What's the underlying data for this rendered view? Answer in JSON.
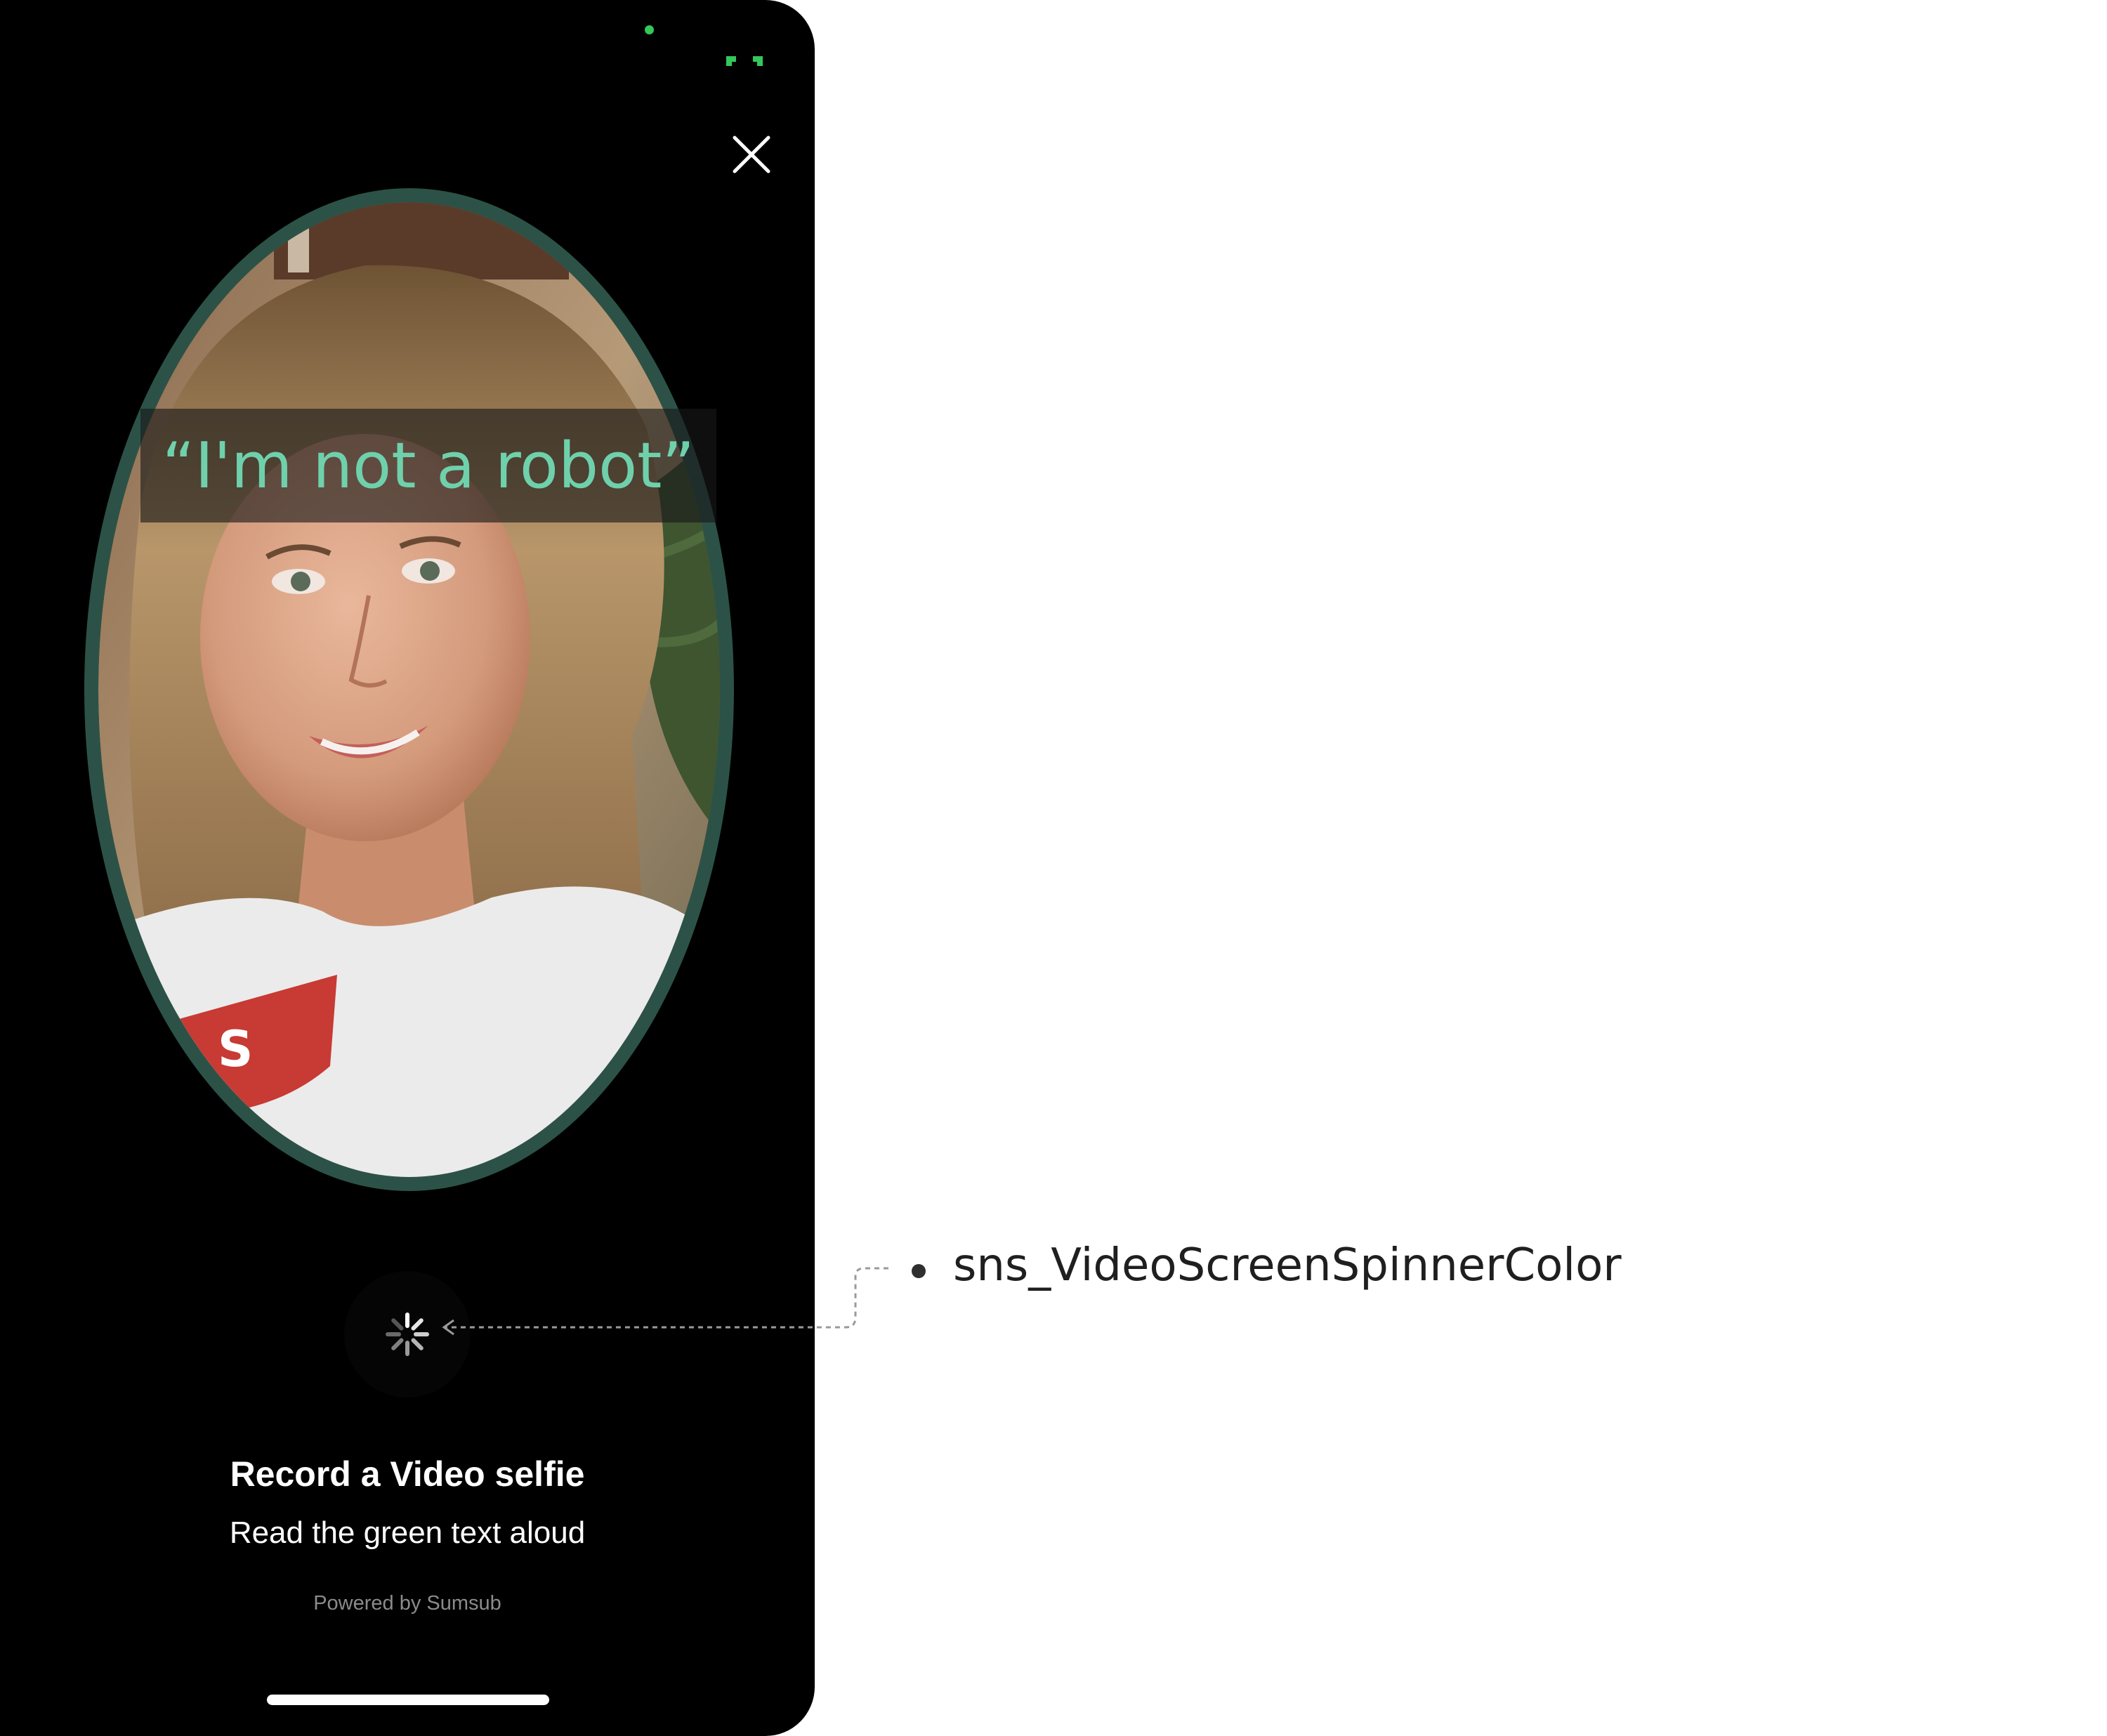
{
  "screen": {
    "prompt": "“I'm not a robot”",
    "title": "Record a Video selfie",
    "subtitle": "Read the green text aloud",
    "powered_by": "Powered by Sumsub"
  },
  "annotation": {
    "label": "sns_VideoScreenSpinnerColor"
  },
  "icons": {
    "close": "close-icon",
    "spinner": "spinner-icon",
    "status": "status-indicator-icon"
  },
  "colors": {
    "background": "#000000",
    "oval_border": "#2c5247",
    "prompt_text": "#6fd1ac",
    "status_green": "#34c759",
    "title_text": "#ffffff",
    "powered_text": "#8b8b8b"
  }
}
